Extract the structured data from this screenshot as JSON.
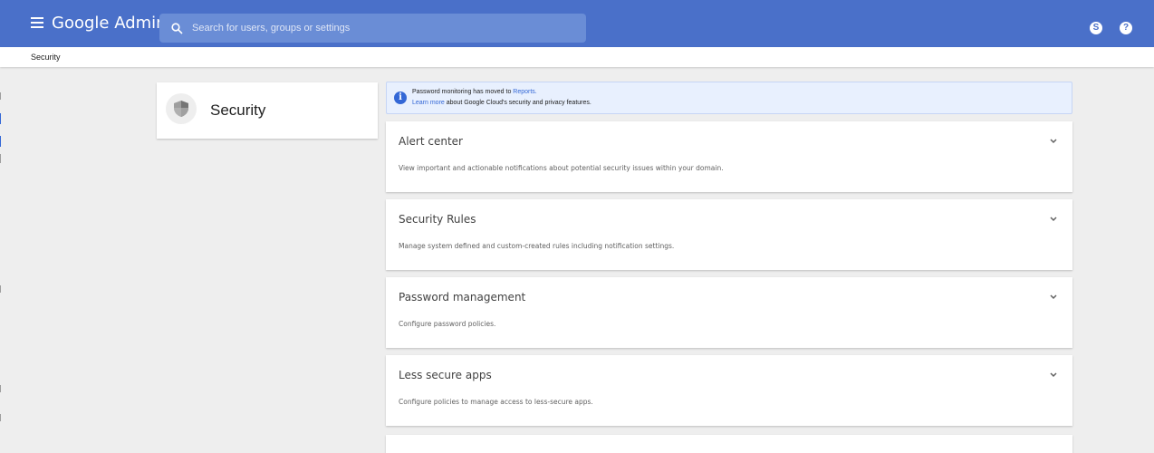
{
  "app": {
    "name": "Google Admin",
    "accent_color": "#4a70c9"
  },
  "header": {
    "search_placeholder": "Search for users, groups or settings",
    "icons": [
      "menu-icon",
      "search-icon",
      "account-circle-icon",
      "help-icon"
    ],
    "account_icon_glyph": "S",
    "help_icon_glyph": "?"
  },
  "breadcrumb": {
    "label": "Security"
  },
  "section": {
    "title": "Security",
    "icon": "shield-icon"
  },
  "banner": {
    "line1_text": "Password monitoring has moved to ",
    "line1_link": "Reports.",
    "line2_link": "Learn more",
    "line2_text": " about Google Cloud's security and privacy features."
  },
  "panels": [
    {
      "title": "Alert center",
      "description": "View important and actionable notifications about potential security issues within your domain."
    },
    {
      "title": "Security Rules",
      "description": "Manage system defined and custom-created rules including notification settings."
    },
    {
      "title": "Password management",
      "description": "Configure password policies."
    },
    {
      "title": "Less secure apps",
      "description": "Configure policies to manage access to less-secure apps."
    }
  ]
}
